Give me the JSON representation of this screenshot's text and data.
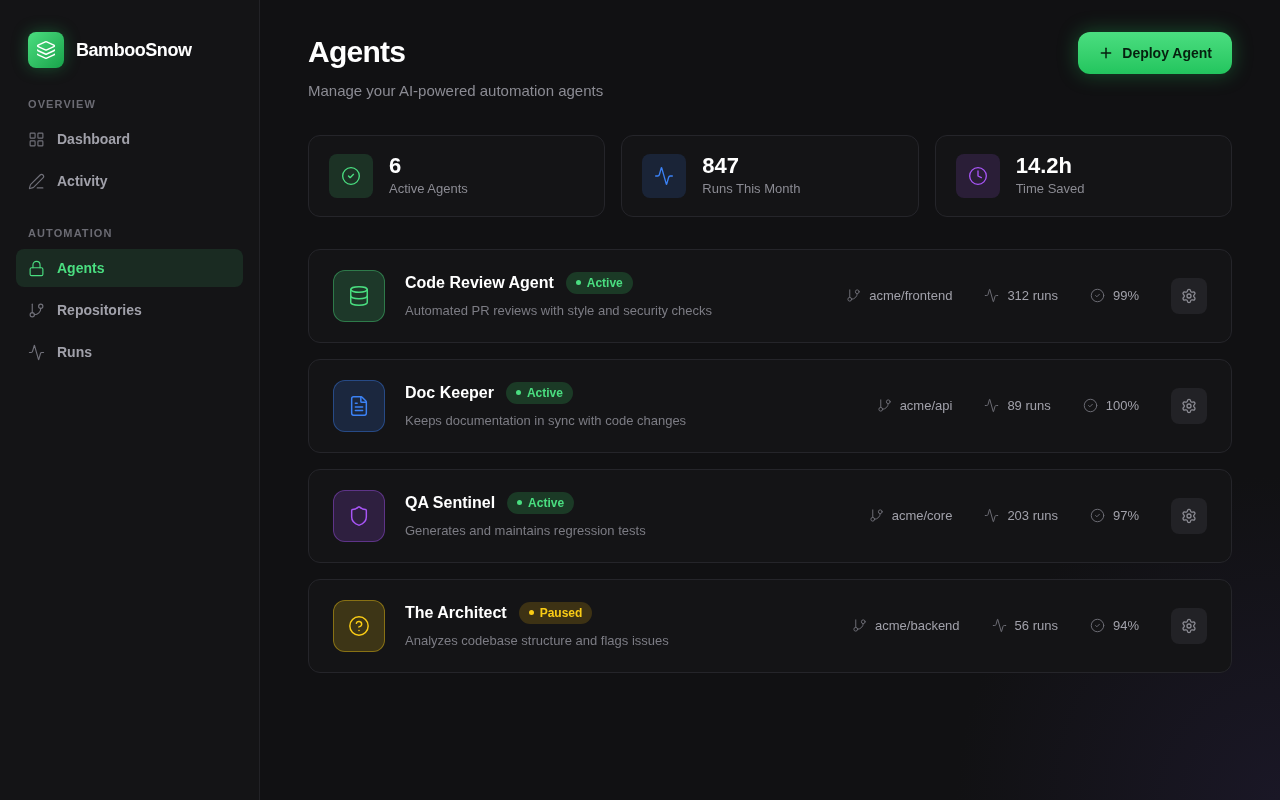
{
  "brand": {
    "name": "BambooSnow"
  },
  "sidebar": {
    "sections": [
      {
        "title": "OVERVIEW",
        "items": [
          {
            "label": "Dashboard",
            "selected": false
          },
          {
            "label": "Activity",
            "selected": false
          }
        ]
      },
      {
        "title": "AUTOMATION",
        "items": [
          {
            "label": "Agents",
            "selected": true
          },
          {
            "label": "Repositories",
            "selected": false
          },
          {
            "label": "Runs",
            "selected": false
          }
        ]
      }
    ]
  },
  "header": {
    "title": "Agents",
    "subtitle": "Manage your AI-powered automation agents",
    "button": "Deploy Agent"
  },
  "stats": [
    {
      "value": "6",
      "label": "Active Agents"
    },
    {
      "value": "847",
      "label": "Runs This Month"
    },
    {
      "value": "14.2h",
      "label": "Time Saved"
    }
  ],
  "agents": [
    {
      "name": "Code Review Agent",
      "status": {
        "kind": "active",
        "label": "Active"
      },
      "description": "Automated PR reviews with style and security checks",
      "repo": "acme/frontend",
      "runs": "312 runs",
      "success": "99%",
      "color": "#4ade80"
    },
    {
      "name": "Doc Keeper",
      "status": {
        "kind": "active",
        "label": "Active"
      },
      "description": "Keeps documentation in sync with code changes",
      "repo": "acme/api",
      "runs": "89 runs",
      "success": "100%",
      "color": "#3b82f6"
    },
    {
      "name": "QA Sentinel",
      "status": {
        "kind": "active",
        "label": "Active"
      },
      "description": "Generates and maintains regression tests",
      "repo": "acme/core",
      "runs": "203 runs",
      "success": "97%",
      "color": "#a855f7"
    },
    {
      "name": "The Architect",
      "status": {
        "kind": "paused",
        "label": "Paused"
      },
      "description": "Analyzes codebase structure and flags issues",
      "repo": "acme/backend",
      "runs": "56 runs",
      "success": "94%",
      "color": "#facc15"
    }
  ]
}
